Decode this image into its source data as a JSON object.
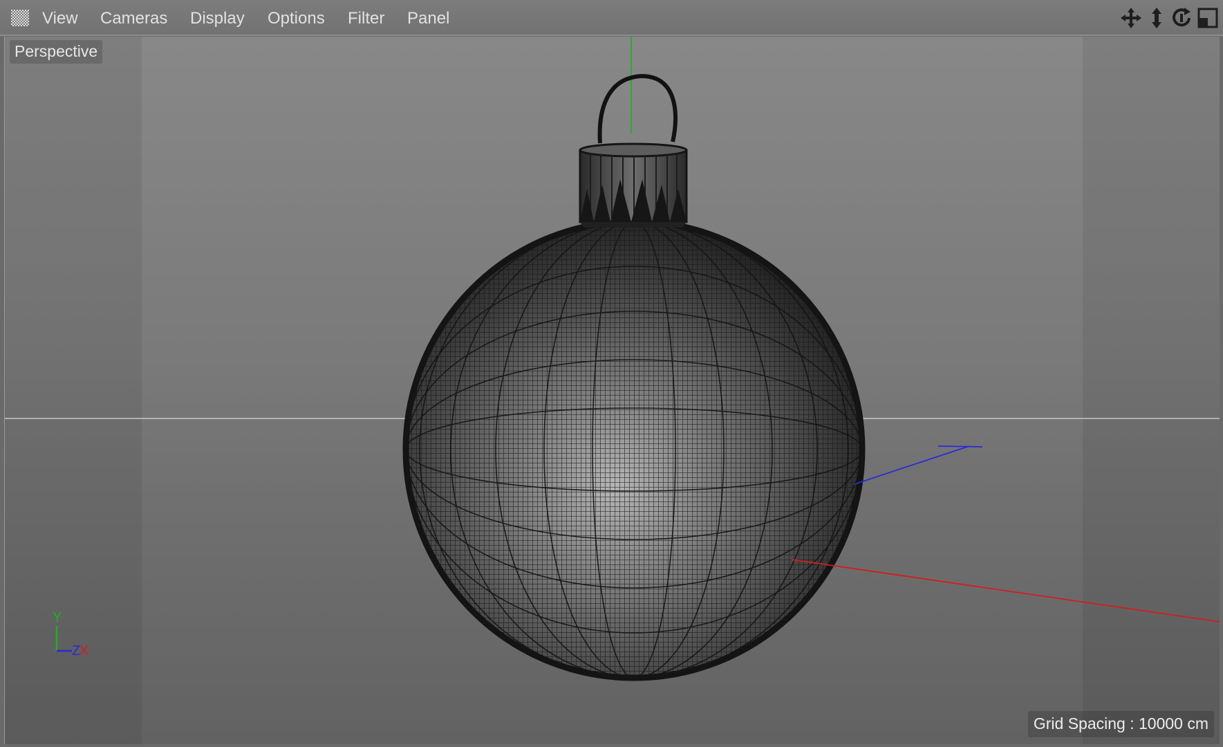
{
  "menu": {
    "items": [
      "View",
      "Cameras",
      "Display",
      "Options",
      "Filter",
      "Panel"
    ]
  },
  "toolbar_icons": [
    "move-view-icon",
    "zoom-view-icon",
    "rotate-view-icon",
    "toggle-layout-icon"
  ],
  "viewport": {
    "camera_label": "Perspective",
    "grid_spacing": "Grid Spacing : 10000 cm",
    "axis_labels": {
      "y": "Y",
      "z": "Z",
      "x": "X"
    },
    "object": "christmas-ornament-wireframe"
  },
  "colors": {
    "menubar_bg": "#767676",
    "viewport_bg_top": "#888888",
    "viewport_bg_bottom": "#626262",
    "axis_x": "#d21e1e",
    "axis_y": "#1fb01f",
    "axis_z": "#2a2ad8",
    "wire": "#1a1a1a",
    "text": "#e2e2e2"
  }
}
